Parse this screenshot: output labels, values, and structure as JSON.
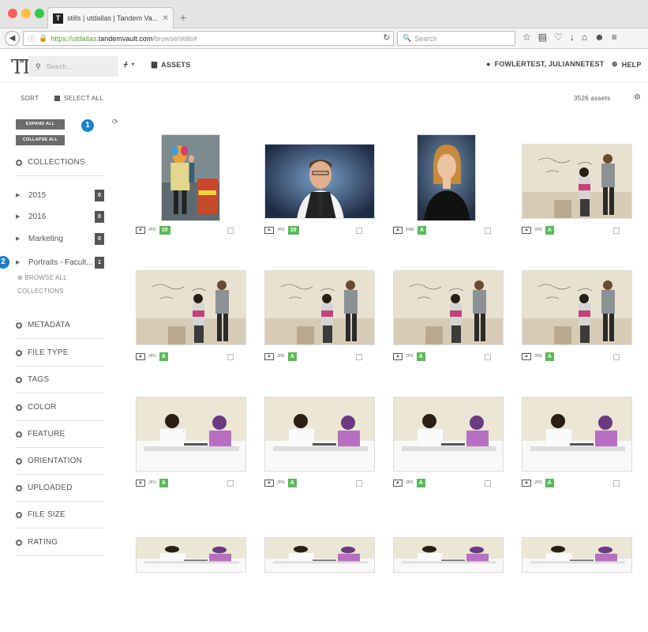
{
  "browser": {
    "tab_title": "stills | utdallas | Tandem Va...",
    "tab_favicon": "T",
    "url_prefix": "https://utdallas.",
    "url_domain": "tandemvault.com",
    "url_path": "/browse/stills#",
    "search_placeholder": "Search"
  },
  "app": {
    "logo": "TT",
    "search_placeholder": "Search...",
    "assets_label": "ASSETS",
    "user_label": "FOWLERTEST, JULIANNETEST",
    "help_label": "HELP"
  },
  "toolbar": {
    "sort_label": "SORT",
    "select_all_label": "SELECT ALL",
    "asset_count": "3526 assets"
  },
  "sidebar": {
    "expand_all": "EXPAND ALL",
    "collapse_all": "COLLAPSE ALL",
    "callout_1": "1",
    "callout_2": "2",
    "collections_title": "COLLECTIONS",
    "collections": [
      {
        "label": "2015",
        "count": "0"
      },
      {
        "label": "2016",
        "count": "0"
      },
      {
        "label": "Marketing",
        "count": "0"
      },
      {
        "label": "Portraits - Facult...",
        "count": "1"
      }
    ],
    "browse_all_line1": "BROWSE ALL",
    "browse_all_line2": "COLLECTIONS",
    "filters": [
      "METADATA",
      "FILE TYPE",
      "TAGS",
      "COLOR",
      "FEATURE",
      "ORIENTATION",
      "UPLOADED",
      "FILE SIZE",
      "RATING"
    ]
  },
  "assets": [
    {
      "ftype": "JPG",
      "badge": "10",
      "img": "costume"
    },
    {
      "ftype": "JPG",
      "badge": "10",
      "img": "portrait-man"
    },
    {
      "ftype": "PNG",
      "badge": "A",
      "img": "portrait-woman"
    },
    {
      "ftype": "JPG",
      "badge": "A",
      "img": "whiteboard"
    },
    {
      "ftype": "JPG",
      "badge": "A",
      "img": "whiteboard"
    },
    {
      "ftype": "JPG",
      "badge": "A",
      "img": "whiteboard"
    },
    {
      "ftype": "JPG",
      "badge": "A",
      "img": "whiteboard"
    },
    {
      "ftype": "JPG",
      "badge": "A",
      "img": "whiteboard"
    },
    {
      "ftype": "JPG",
      "badge": "A",
      "img": "classroom"
    },
    {
      "ftype": "JPG",
      "badge": "A",
      "img": "classroom"
    },
    {
      "ftype": "JPG",
      "badge": "A",
      "img": "classroom"
    },
    {
      "ftype": "JPG",
      "badge": "A",
      "img": "classroom"
    },
    {
      "ftype": "",
      "badge": "",
      "img": "classroom"
    },
    {
      "ftype": "",
      "badge": "",
      "img": "classroom"
    },
    {
      "ftype": "",
      "badge": "",
      "img": "classroom"
    },
    {
      "ftype": "",
      "badge": "",
      "img": "classroom"
    }
  ],
  "colors": {
    "badge_green": "#5cb85c",
    "callout_blue": "#1f7fc4",
    "count_badge": "#555555"
  }
}
